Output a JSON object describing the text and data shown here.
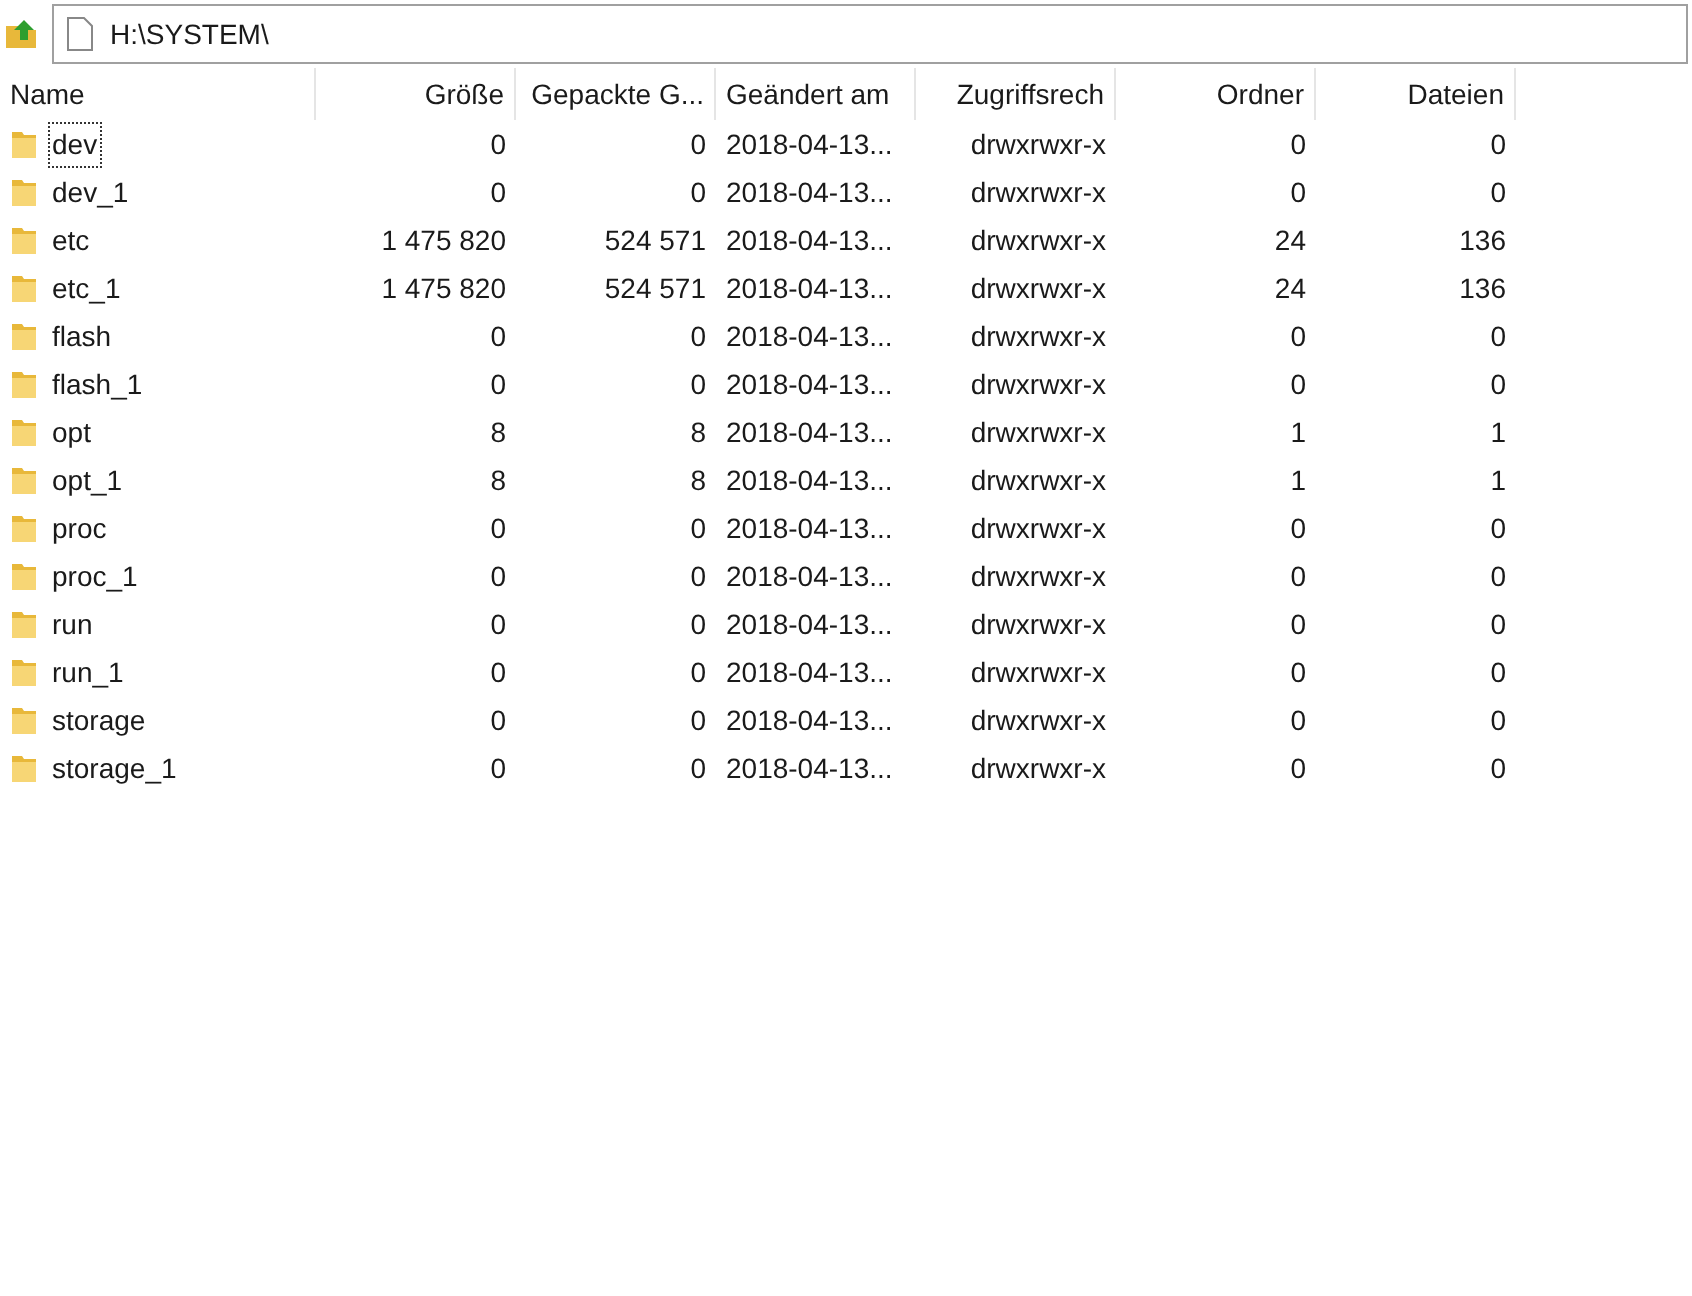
{
  "address_bar": {
    "path": "H:\\SYSTEM\\"
  },
  "table": {
    "columns": [
      {
        "label": "Name"
      },
      {
        "label": "Größe"
      },
      {
        "label": "Gepackte G..."
      },
      {
        "label": "Geändert am"
      },
      {
        "label": "Zugriffsrech"
      },
      {
        "label": "Ordner"
      },
      {
        "label": "Dateien"
      }
    ],
    "rows": [
      {
        "focused": true,
        "cells": [
          "dev",
          "0",
          "0",
          "2018-04-13...",
          "drwxrwxr-x",
          "0",
          "0"
        ]
      },
      {
        "focused": false,
        "cells": [
          "dev_1",
          "0",
          "0",
          "2018-04-13...",
          "drwxrwxr-x",
          "0",
          "0"
        ]
      },
      {
        "focused": false,
        "cells": [
          "etc",
          "1 475 820",
          "524 571",
          "2018-04-13...",
          "drwxrwxr-x",
          "24",
          "136"
        ]
      },
      {
        "focused": false,
        "cells": [
          "etc_1",
          "1 475 820",
          "524 571",
          "2018-04-13...",
          "drwxrwxr-x",
          "24",
          "136"
        ]
      },
      {
        "focused": false,
        "cells": [
          "flash",
          "0",
          "0",
          "2018-04-13...",
          "drwxrwxr-x",
          "0",
          "0"
        ]
      },
      {
        "focused": false,
        "cells": [
          "flash_1",
          "0",
          "0",
          "2018-04-13...",
          "drwxrwxr-x",
          "0",
          "0"
        ]
      },
      {
        "focused": false,
        "cells": [
          "opt",
          "8",
          "8",
          "2018-04-13...",
          "drwxrwxr-x",
          "1",
          "1"
        ]
      },
      {
        "focused": false,
        "cells": [
          "opt_1",
          "8",
          "8",
          "2018-04-13...",
          "drwxrwxr-x",
          "1",
          "1"
        ]
      },
      {
        "focused": false,
        "cells": [
          "proc",
          "0",
          "0",
          "2018-04-13...",
          "drwxrwxr-x",
          "0",
          "0"
        ]
      },
      {
        "focused": false,
        "cells": [
          "proc_1",
          "0",
          "0",
          "2018-04-13...",
          "drwxrwxr-x",
          "0",
          "0"
        ]
      },
      {
        "focused": false,
        "cells": [
          "run",
          "0",
          "0",
          "2018-04-13...",
          "drwxrwxr-x",
          "0",
          "0"
        ]
      },
      {
        "focused": false,
        "cells": [
          "run_1",
          "0",
          "0",
          "2018-04-13...",
          "drwxrwxr-x",
          "0",
          "0"
        ]
      },
      {
        "focused": false,
        "cells": [
          "storage",
          "0",
          "0",
          "2018-04-13...",
          "drwxrwxr-x",
          "0",
          "0"
        ]
      },
      {
        "focused": false,
        "cells": [
          "storage_1",
          "0",
          "0",
          "2018-04-13...",
          "drwxrwxr-x",
          "0",
          "0"
        ]
      }
    ]
  }
}
